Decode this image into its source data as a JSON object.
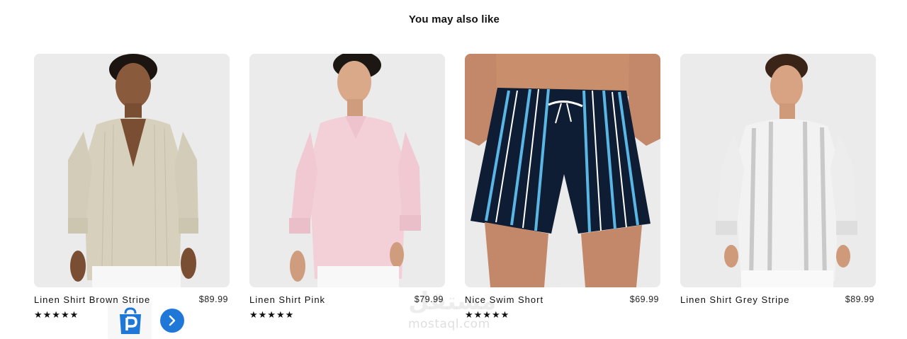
{
  "section": {
    "title": "You may also like"
  },
  "products": [
    {
      "title": "Linen Shirt Brown Stripe",
      "price": "$89.99",
      "stars": "★★★★★",
      "image": "model-beige-linen-shirt"
    },
    {
      "title": "Linen Shirt Pink",
      "price": "$79.99",
      "stars": "★★★★★",
      "image": "model-pink-linen-shirt"
    },
    {
      "title": "Nice Swim Short",
      "price": "$69.99",
      "stars": "★★★★★",
      "image": "navy-striped-swim-short"
    },
    {
      "title": "Linen Shirt Grey Stripe",
      "price": "$89.99",
      "stars": "",
      "image": "model-grey-stripe-linen-shirt"
    }
  ],
  "overlay": {
    "app_badge_icon": "shopping-bag-p-icon",
    "next_icon": "chevron-right-icon",
    "watermark_arabic": "مستقل",
    "watermark_latin": "mostaql.com"
  },
  "colors": {
    "image_bg": "#ebebeb",
    "button_blue": "#1f78d8",
    "text": "#111111"
  }
}
